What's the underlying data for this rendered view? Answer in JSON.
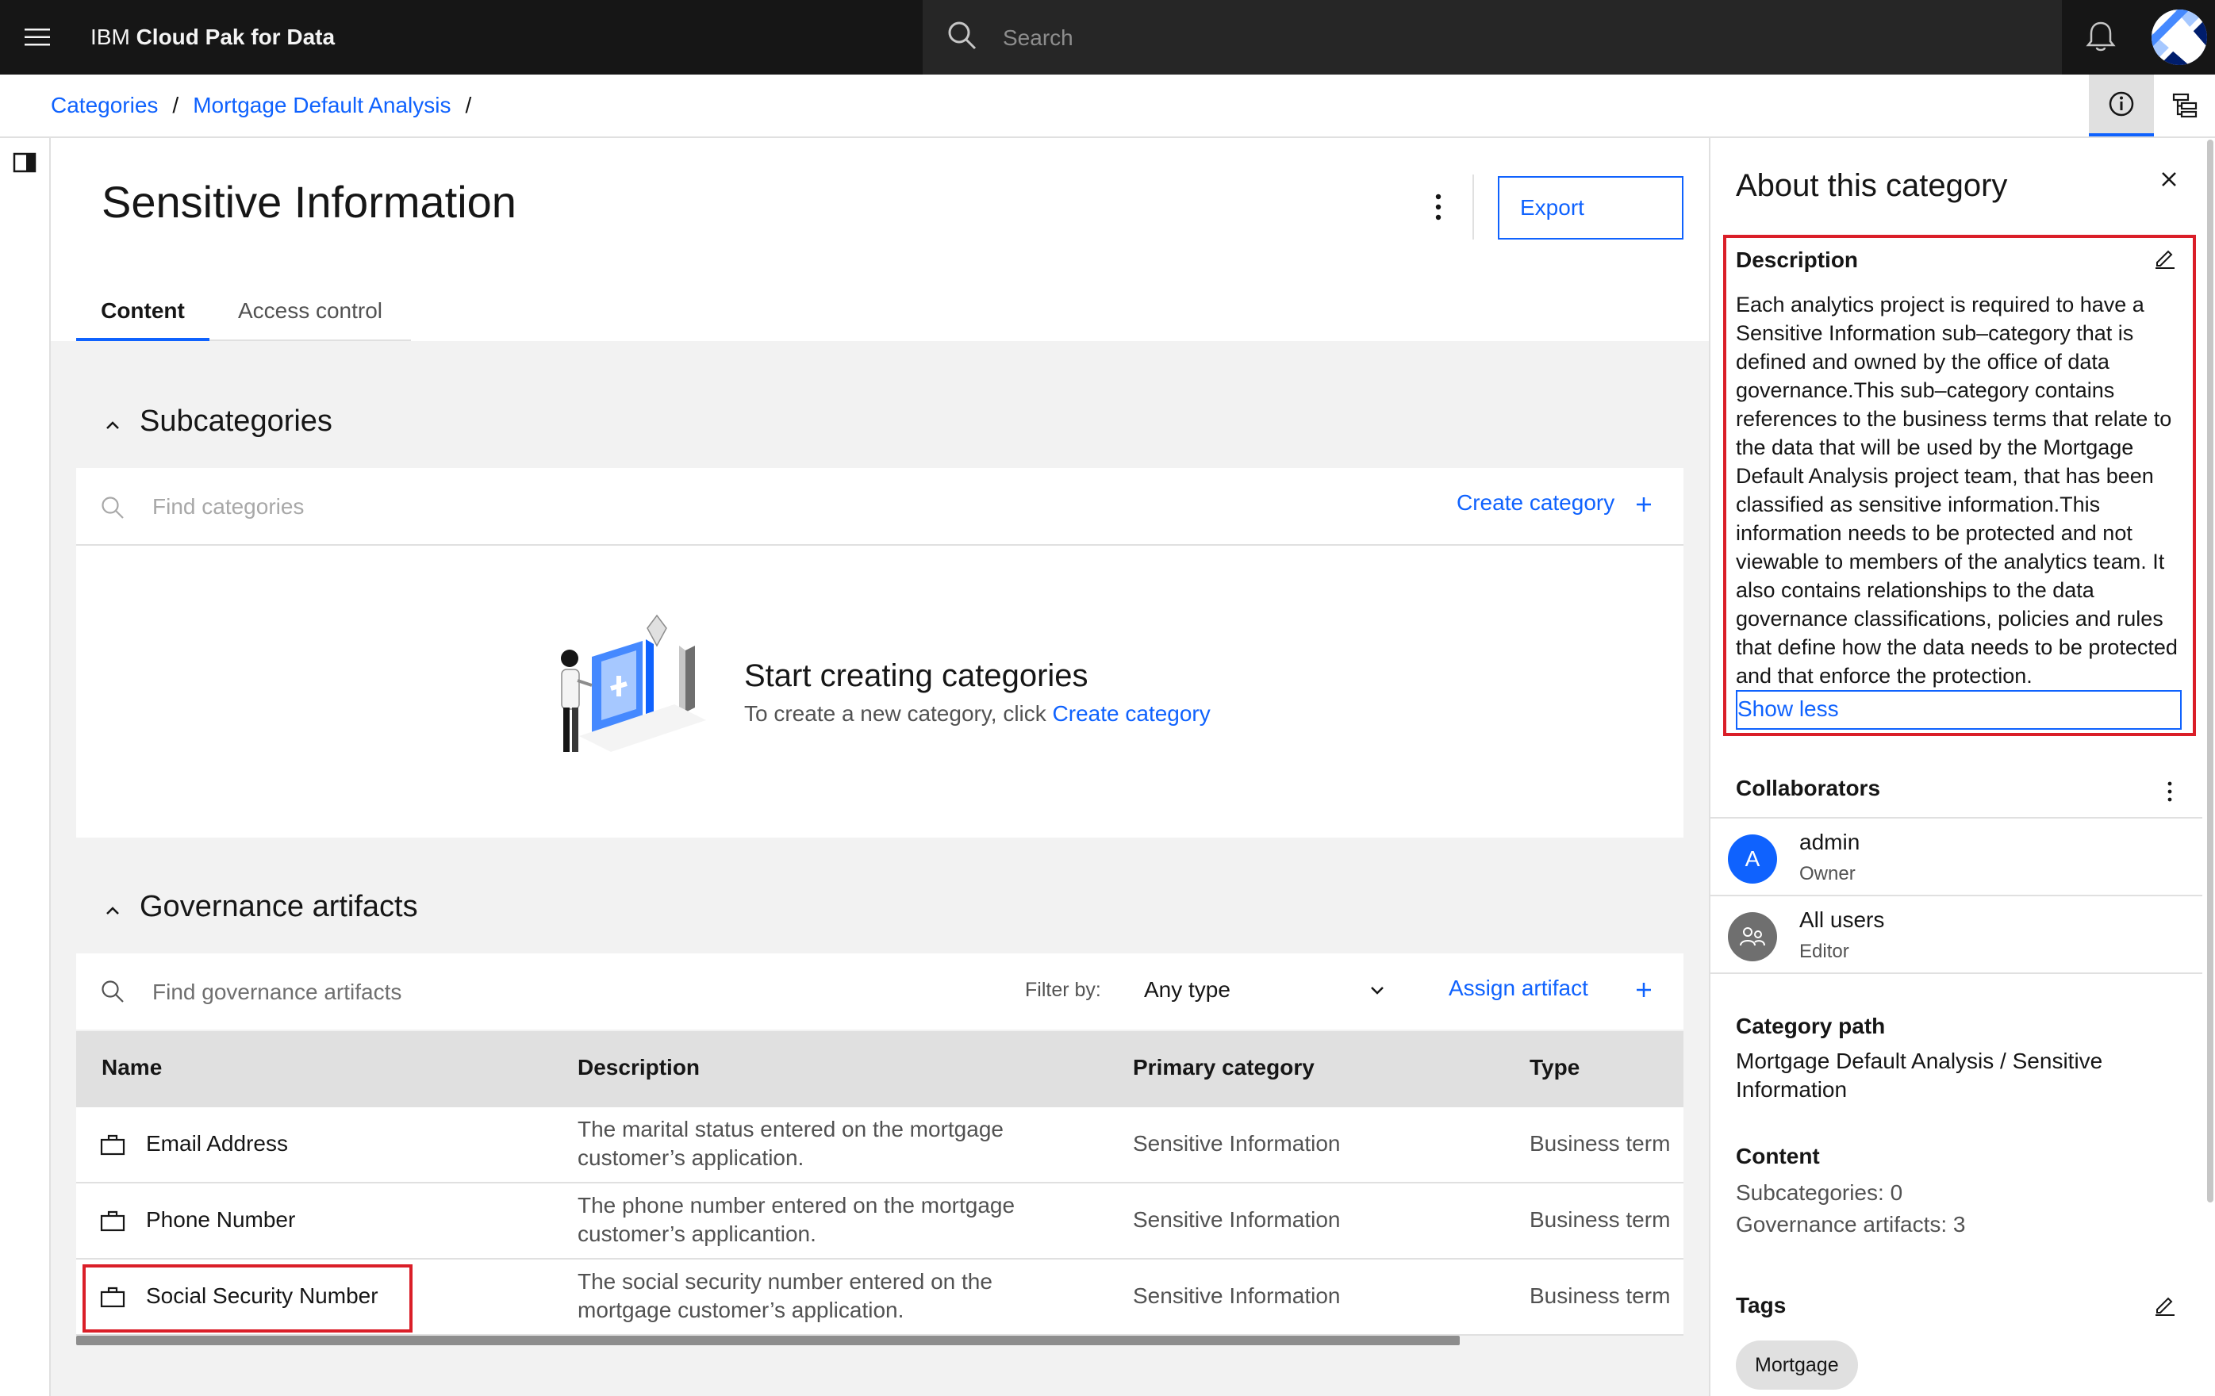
{
  "header": {
    "brand_prefix": "IBM",
    "brand_name": "Cloud Pak for Data",
    "search_placeholder": "Search"
  },
  "breadcrumb": {
    "items": [
      "Categories",
      "Mortgage Default Analysis"
    ],
    "separator": "/"
  },
  "page": {
    "title": "Sensitive Information",
    "export_label": "Export",
    "tabs": [
      {
        "label": "Content",
        "selected": true
      },
      {
        "label": "Access control",
        "selected": false
      }
    ]
  },
  "subcategories": {
    "title": "Subcategories",
    "search_placeholder": "Find categories",
    "create_label": "Create category",
    "empty_title": "Start creating categories",
    "empty_text": "To create a new category, click",
    "empty_link": "Create category"
  },
  "governance": {
    "title": "Governance artifacts",
    "search_placeholder": "Find governance artifacts",
    "filter_label": "Filter by:",
    "filter_value": "Any type",
    "assign_label": "Assign artifact",
    "columns": [
      "Name",
      "Description",
      "Primary category",
      "Type"
    ],
    "rows": [
      {
        "name": "Email Address",
        "description": "The marital status entered on the mortgage customer’s application.",
        "primary_category": "Sensitive Information",
        "type": "Business term"
      },
      {
        "name": "Phone Number",
        "description": "The phone number entered on the mortgage customer’s applicantion.",
        "primary_category": "Sensitive Information",
        "type": "Business term"
      },
      {
        "name": "Social Security Number",
        "description": "The social security number entered on the mortgage customer’s application.",
        "primary_category": "Sensitive Information",
        "type": "Business term"
      }
    ]
  },
  "about": {
    "title": "About this category",
    "description_label": "Description",
    "description": "Each analytics project is required to have a Sensitive Information sub–category that is defined and owned by the office of data governance.This sub–category contains references to the business terms that relate to the data that will be used by the Mortgage Default Analysis project team, that has been classified as sensitive information.This information needs to be protected and not viewable to members of the analytics team. It also contains relationships to the data governance classifications, policies and rules that define how the data needs to be protected and that enforce the protection.",
    "show_less_label": "Show less",
    "collaborators_label": "Collaborators",
    "collaborators": [
      {
        "initial": "A",
        "name": "admin",
        "role": "Owner"
      },
      {
        "name": "All users",
        "role": "Editor"
      }
    ],
    "category_path_label": "Category path",
    "category_path": "Mortgage Default Analysis  / Sensitive Information",
    "content_label": "Content",
    "subcategories_count_text": "Subcategories:  0",
    "governance_count_text": "Governance artifacts:  3",
    "tags_label": "Tags",
    "tags": [
      "Mortgage"
    ]
  },
  "colors": {
    "accent": "#0f62fe",
    "header_bg": "#161616",
    "highlight": "#da1e28"
  }
}
